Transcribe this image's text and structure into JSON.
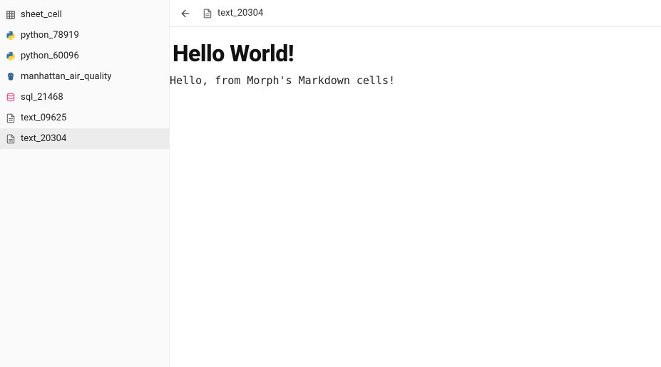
{
  "sidebar": {
    "items": [
      {
        "icon": "table-icon",
        "label": "sheet_cell",
        "active": false
      },
      {
        "icon": "python-icon",
        "label": "python_78919",
        "active": false
      },
      {
        "icon": "python-icon",
        "label": "python_60096",
        "active": false
      },
      {
        "icon": "postgres-icon",
        "label": "manhattan_air_quality",
        "active": false
      },
      {
        "icon": "sql-icon",
        "label": "sql_21468",
        "active": false
      },
      {
        "icon": "text-icon",
        "label": "text_09625",
        "active": false
      },
      {
        "icon": "text-icon",
        "label": "text_20304",
        "active": true
      }
    ]
  },
  "topbar": {
    "file_icon": "text-icon",
    "file_name": "text_20304"
  },
  "content": {
    "heading": "Hello World!",
    "body": "Hello, from Morph's Markdown cells!"
  }
}
